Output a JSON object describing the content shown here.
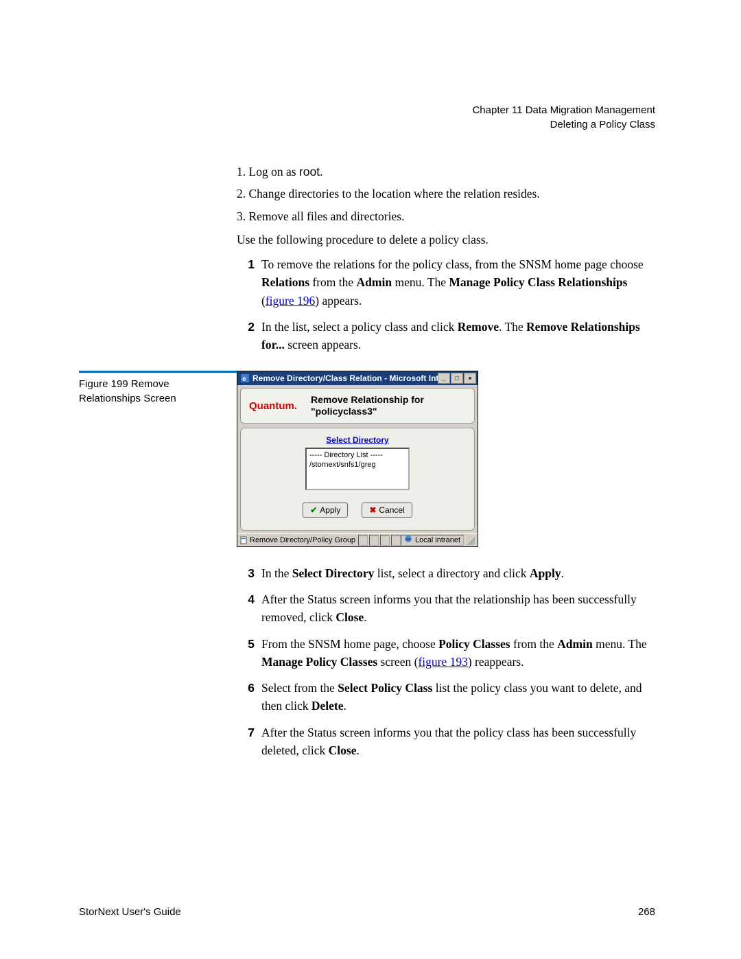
{
  "header": {
    "chapter": "Chapter 11  Data Migration Management",
    "section": "Deleting a Policy Class"
  },
  "prelist": {
    "p1a": "1. Log on as ",
    "p1b": "root",
    "p1c": ".",
    "p2": "2. Change directories to the location where the relation resides.",
    "p3": "3. Remove all files and directories."
  },
  "intro": "Use the following procedure to delete a policy class.",
  "steps1": {
    "s1": {
      "n": "1",
      "a": "To remove the relations for the policy class, from the SNSM home page choose ",
      "b": "Relations",
      "c": " from the ",
      "d": "Admin",
      "e": " menu. The ",
      "f": "Manage Policy Class Relationships",
      "g": " (",
      "link": "figure 196",
      "h": ") appears."
    },
    "s2": {
      "n": "2",
      "a": "In the list, select a policy class and click ",
      "b": "Remove",
      "c": ". The ",
      "d": "Remove Relationships for...",
      "e": " screen appears."
    }
  },
  "figure": {
    "label1": "Figure 199  Remove",
    "label2": "Relationships Screen"
  },
  "dialog": {
    "title": "Remove Directory/Class Relation - Microsoft Internet Explorer",
    "brand": "Quantum.",
    "heading1": "Remove Relationship for",
    "heading2": "\"policyclass3\"",
    "select_label": "Select Directory",
    "list_header": "----- Directory List -----",
    "list_item": "/stornext/snfs1/greg",
    "apply": "Apply",
    "cancel": "Cancel",
    "status_left": "Remove Directory/Policy Group",
    "status_right": "Local intranet"
  },
  "steps2": {
    "s3": {
      "n": "3",
      "a": "In the ",
      "b": "Select Directory",
      "c": " list, select a directory and click ",
      "d": "Apply",
      "e": "."
    },
    "s4": {
      "n": "4",
      "a": "After the Status screen informs you that the relationship has been successfully removed, click ",
      "b": "Close",
      "c": "."
    },
    "s5": {
      "n": "5",
      "a": "From the SNSM home page, choose ",
      "b": "Policy Classes",
      "c": " from the ",
      "d": "Admin",
      "e": " menu. The ",
      "f": "Manage Policy Classes",
      "g": " screen (",
      "link": "figure 193",
      "h": ") reappears."
    },
    "s6": {
      "n": "6",
      "a": "Select from the ",
      "b": "Select Policy Class",
      "c": " list the policy class you want to delete, and then click ",
      "d": "Delete",
      "e": "."
    },
    "s7": {
      "n": "7",
      "a": "After the Status screen informs you that the policy class has been successfully deleted, click ",
      "b": "Close",
      "c": "."
    }
  },
  "footer": {
    "left": "StorNext User's Guide",
    "right": "268"
  }
}
